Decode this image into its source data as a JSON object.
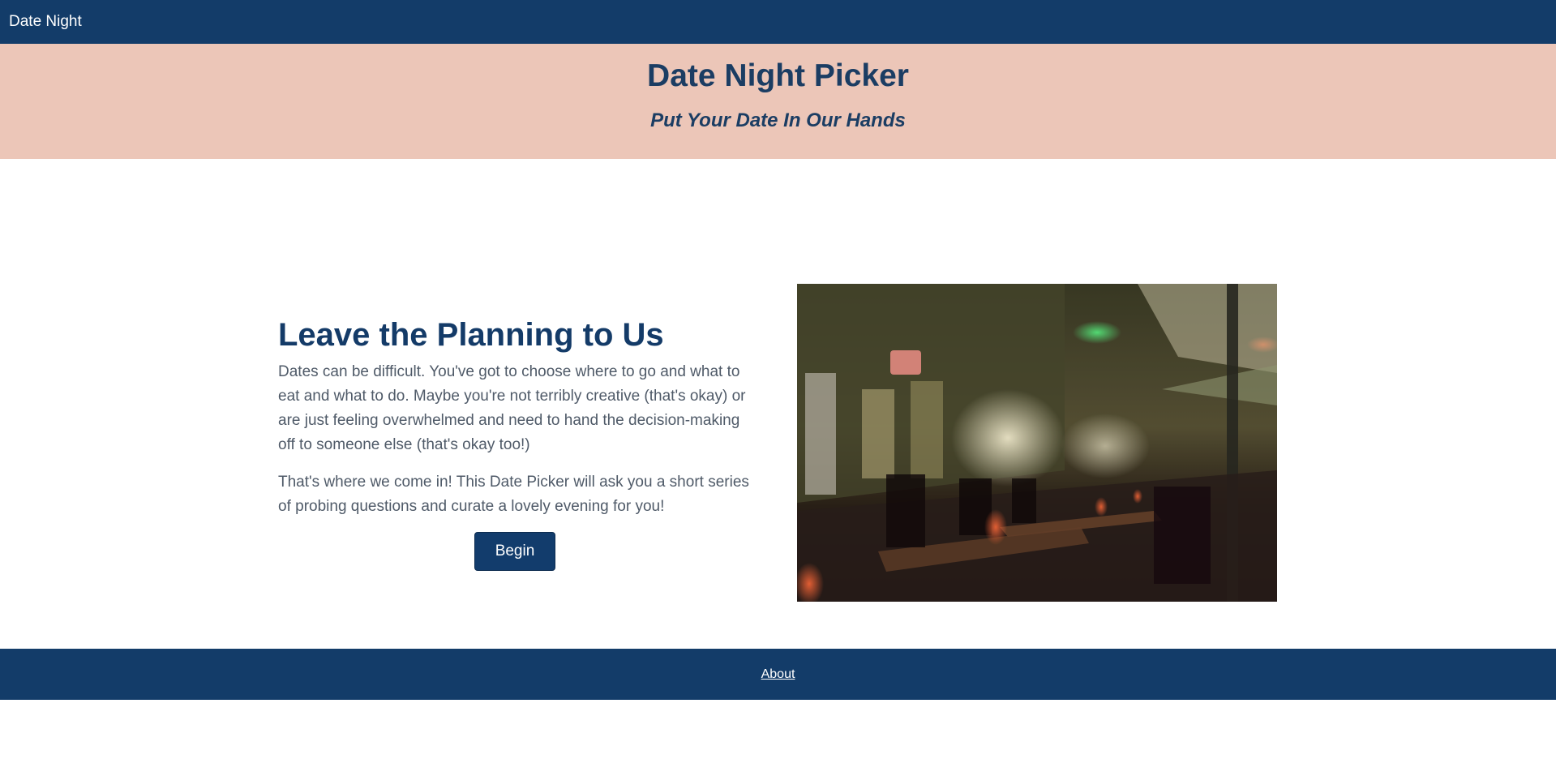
{
  "navbar": {
    "brand": "Date Night"
  },
  "hero": {
    "title": "Date Night Picker",
    "subtitle": "Put Your Date In Our Hands"
  },
  "main": {
    "heading": "Leave the Planning to Us",
    "paragraphs": [
      "Dates can be difficult. You've got to choose where to go and what to eat and what to do. Maybe you're not terribly creative (that's okay) or are just feeling overwhelmed and need to hand the decision-making off to someone else (that's okay too!)",
      "That's where we come in! This Date Picker will ask you a short series of probing questions and curate a lovely evening for you!"
    ],
    "begin_label": "Begin"
  },
  "footer": {
    "about_label": "About"
  },
  "colors": {
    "navy": "#133c69",
    "blush": "#ecc6b8",
    "text_muted": "#4f5a68"
  }
}
